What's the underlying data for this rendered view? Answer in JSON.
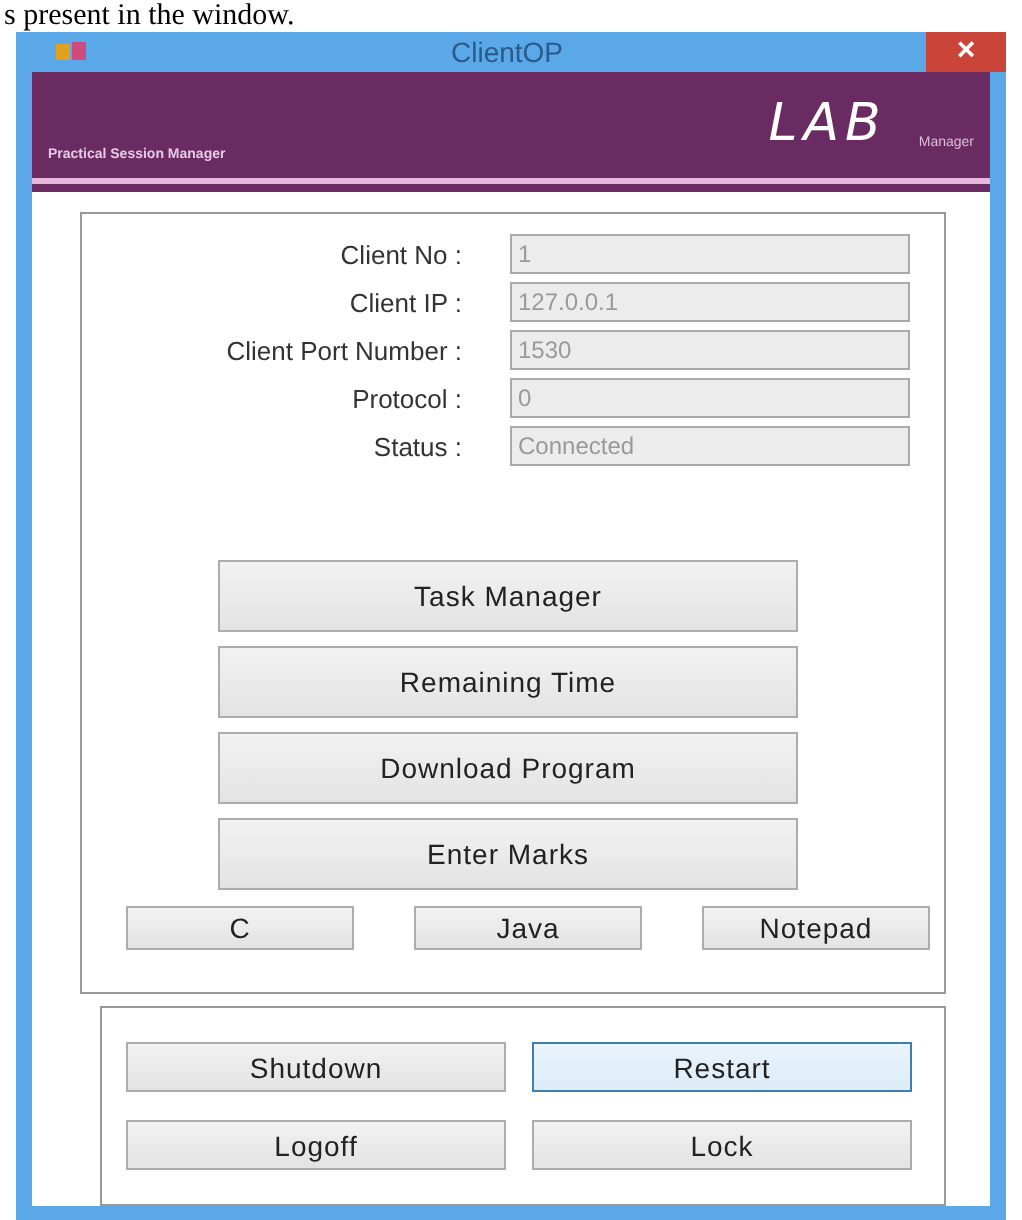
{
  "caption": "s present in the window.",
  "window": {
    "title": "ClientOP",
    "close": "×"
  },
  "banner": {
    "subtitle": "Practical Session Manager",
    "logo": "LAB",
    "logo_suffix": "Manager"
  },
  "fields": [
    {
      "label": "Client No :",
      "value": "1",
      "disabled": true
    },
    {
      "label": "Client IP :",
      "value": "127.0.0.1",
      "disabled": true
    },
    {
      "label": "Client Port Number :",
      "value": "1530",
      "disabled": true
    },
    {
      "label": "Protocol :",
      "value": "0",
      "disabled": true
    },
    {
      "label": "Status :",
      "value": "Connected",
      "disabled": true
    }
  ],
  "actions": [
    {
      "label": "Task Manager"
    },
    {
      "label": "Remaining Time"
    },
    {
      "label": "Download Program"
    },
    {
      "label": "Enter Marks"
    }
  ],
  "launchers": [
    {
      "label": "C"
    },
    {
      "label": "Java"
    },
    {
      "label": "Notepad"
    }
  ],
  "power": [
    {
      "label": "Shutdown",
      "focused": false
    },
    {
      "label": "Restart",
      "focused": true
    },
    {
      "label": "Logoff",
      "focused": false
    },
    {
      "label": "Lock",
      "focused": false
    }
  ]
}
